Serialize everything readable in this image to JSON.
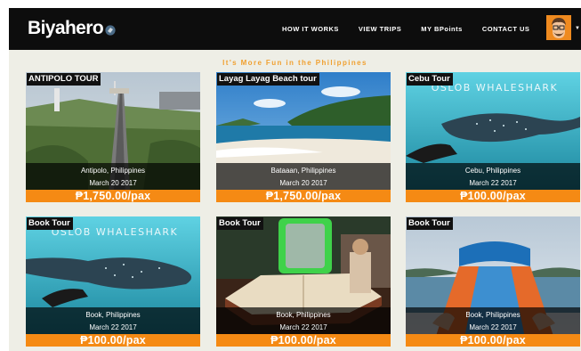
{
  "brand": {
    "name": "Biyahero"
  },
  "nav": [
    {
      "label": "HOW IT WORKS"
    },
    {
      "label": "VIEW TRIPS"
    },
    {
      "label": "MY BPoints"
    },
    {
      "label": "CONTACT US"
    }
  ],
  "tagline": "It's More Fun in the Philippines",
  "colors": {
    "accent": "#f58a14",
    "navbar": "#0d0d0d",
    "tagline": "#f0a030",
    "background": "#eeeee6"
  },
  "cards": [
    {
      "tag": "ANTIPOLO TOUR",
      "location": "Antipolo, Philippines",
      "date": "March 20 2017",
      "price": "₱1,750.00/pax"
    },
    {
      "tag": "Layag Layag Beach tour",
      "location": "Bataaan, Philippines",
      "date": "March 20 2017",
      "price": "₱1,750.00/pax"
    },
    {
      "tag": "Cebu Tour",
      "image_text": "OSLOB WHALESHARK",
      "location": "Cebu, Philippines",
      "date": "March 22 2017",
      "price": "₱100.00/pax"
    },
    {
      "tag": "Book Tour",
      "image_text": "OSLOB WHALESHARK",
      "location": "Book, Philippines",
      "date": "March 22 2017",
      "price": "₱100.00/pax"
    },
    {
      "tag": "Book Tour",
      "location": "Book, Philippines",
      "date": "March 22 2017",
      "price": "₱100.00/pax"
    },
    {
      "tag": "Book Tour",
      "location": "Book, Philippines",
      "date": "March 22 2017",
      "price": "₱100.00/pax"
    }
  ]
}
